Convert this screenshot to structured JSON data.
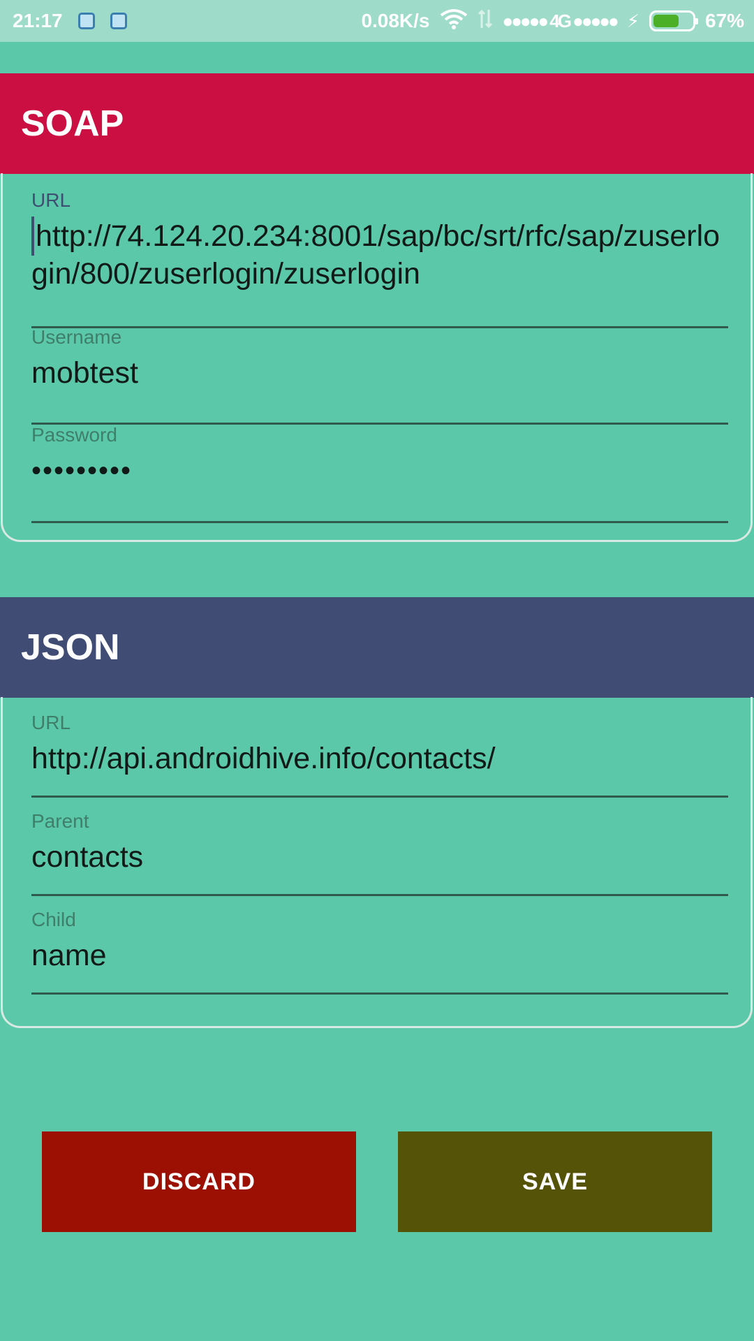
{
  "status_bar": {
    "time": "21:17",
    "net_speed": "0.08K/s",
    "signal_text": "●●●●● 4G ●●●●●",
    "battery_percent_text": "67%",
    "battery_level": 0.67,
    "icons": [
      "notification-icon",
      "notification-icon",
      "wifi-icon",
      "data-arrows-icon",
      "charging-bolt-icon",
      "battery-icon"
    ]
  },
  "soap": {
    "title": "SOAP",
    "url_label": "URL",
    "url_value": "http://74.124.20.234:8001/sap/bc/srt/rfc/sap/zuserlogin/800/zuserlogin/zuserlogin",
    "username_label": "Username",
    "username_value": "mobtest",
    "password_label": "Password",
    "password_value": "•••••••••"
  },
  "json": {
    "title": "JSON",
    "url_label": "URL",
    "url_value": "http://api.androidhive.info/contacts/",
    "parent_label": "Parent",
    "parent_value": "contacts",
    "child_label": "Child",
    "child_value": "name"
  },
  "actions": {
    "discard_label": "DISCARD",
    "save_label": "SAVE"
  },
  "colors": {
    "background": "#5bc8aa",
    "soap_header": "#cb0f42",
    "json_header": "#404c74",
    "discard": "#9c0f03",
    "save": "#545307"
  }
}
